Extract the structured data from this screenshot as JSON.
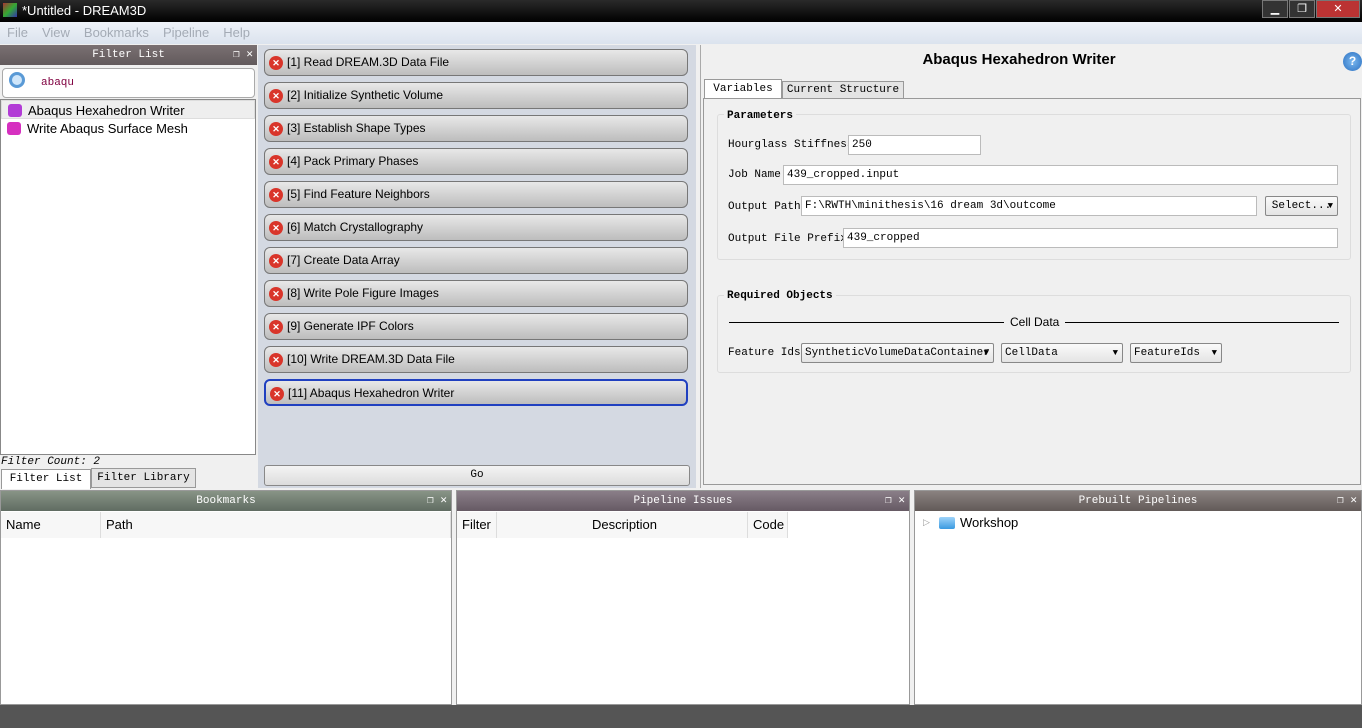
{
  "window": {
    "title": "*Untitled - DREAM3D",
    "minimize": "▁",
    "restore": "❐",
    "close": "✕"
  },
  "menu": [
    "File",
    "View",
    "Bookmarks",
    "Pipeline",
    "Help"
  ],
  "filter_list": {
    "title": "Filter List",
    "search_value": "abaqu",
    "items": [
      "Abaqus Hexahedron Writer",
      "Write Abaqus Surface Mesh"
    ],
    "count": "Filter Count: 2",
    "tabs": [
      "Filter List",
      "Filter Library"
    ]
  },
  "pipeline": {
    "items": [
      "[1] Read DREAM.3D Data File",
      "[2] Initialize Synthetic Volume",
      "[3] Establish Shape Types",
      "[4] Pack Primary Phases",
      "[5] Find Feature Neighbors",
      "[6] Match Crystallography",
      "[7] Create Data Array",
      "[8] Write Pole Figure Images",
      "[9] Generate IPF Colors",
      "[10] Write DREAM.3D Data File",
      "[11] Abaqus Hexahedron Writer"
    ],
    "selected_index": 10,
    "go": "Go"
  },
  "filter_input": {
    "title": "Abaqus Hexahedron Writer",
    "help": "?",
    "tabs": [
      "Variables",
      "Current Structure"
    ],
    "parameters_title": "Parameters",
    "hourglass_label": "Hourglass Stiffness",
    "hourglass_value": "250",
    "job_label": "Job Name",
    "job_value": "439_cropped.input",
    "path_label": "Output Path",
    "path_value": "F:\\RWTH\\minithesis\\16 dream 3d\\outcome",
    "select": "Select...",
    "prefix_label": "Output File Prefix",
    "prefix_value": "439_cropped",
    "required_title": "Required Objects",
    "cell_data": "Cell Data",
    "feature_label": "Feature Ids",
    "combo1": "SyntheticVolumeDataContainer",
    "combo2": "CellData",
    "combo3": "FeatureIds"
  },
  "bookmarks": {
    "title": "Bookmarks",
    "columns": [
      "Name",
      "Path"
    ]
  },
  "issues": {
    "title": "Pipeline Issues",
    "columns": [
      "Filter",
      "Description",
      "Code"
    ]
  },
  "prebuilt": {
    "title": "Prebuilt Pipelines",
    "items": [
      "Workshop"
    ]
  },
  "colors": {
    "bookmarks_header": "#68746a",
    "issues_header": "#746670",
    "prebuilt_header": "#6e6664",
    "selection": "#2040c0",
    "error": "#d9352a"
  }
}
